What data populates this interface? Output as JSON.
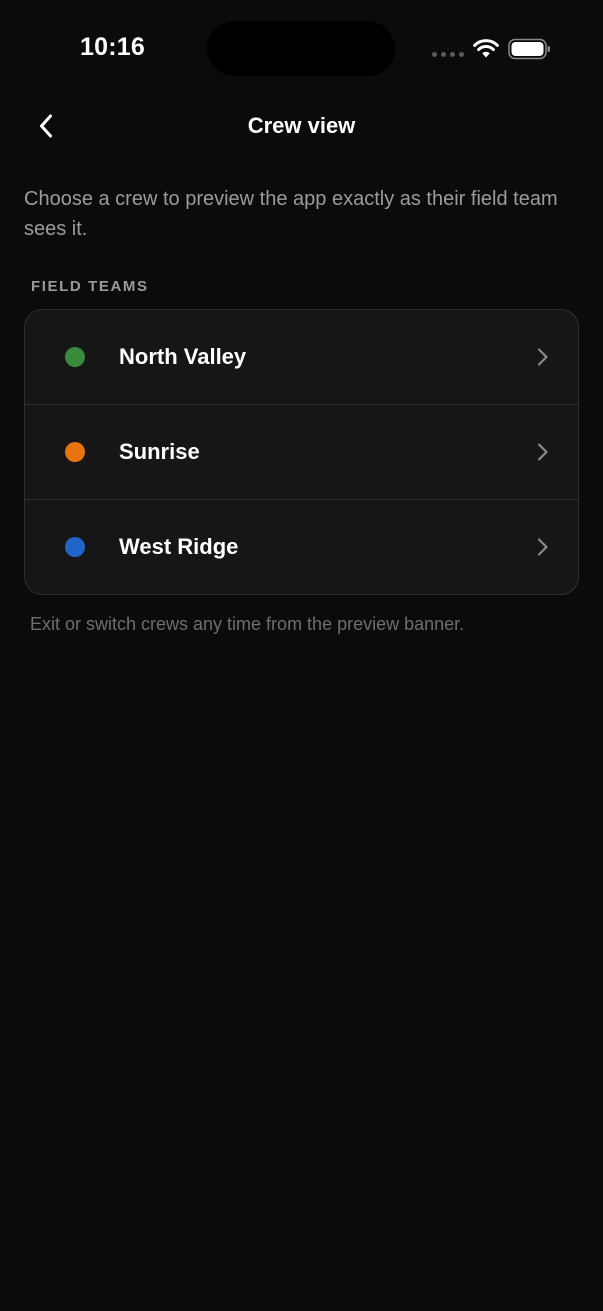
{
  "status_bar": {
    "time": "10:16",
    "icons": [
      "signal-dots-icon",
      "wifi-icon",
      "battery-icon"
    ]
  },
  "nav": {
    "title": "Crew view",
    "back_icon": "chevron-left-icon"
  },
  "intro": "Choose a crew to preview the app exactly as their field team sees it.",
  "section": {
    "title": "FIELD TEAMS"
  },
  "teams": [
    {
      "name": "North Valley",
      "color": "#3a8a3c"
    },
    {
      "name": "Sunrise",
      "color": "#e8740f"
    },
    {
      "name": "West Ridge",
      "color": "#1f66c8"
    }
  ],
  "footnote": "Exit or switch crews any time from the preview banner.",
  "colors": {
    "background": "#0b0b0b",
    "card": "#161616",
    "divider": "#2e2e2e",
    "secondary_text": "#9b9b9b"
  }
}
